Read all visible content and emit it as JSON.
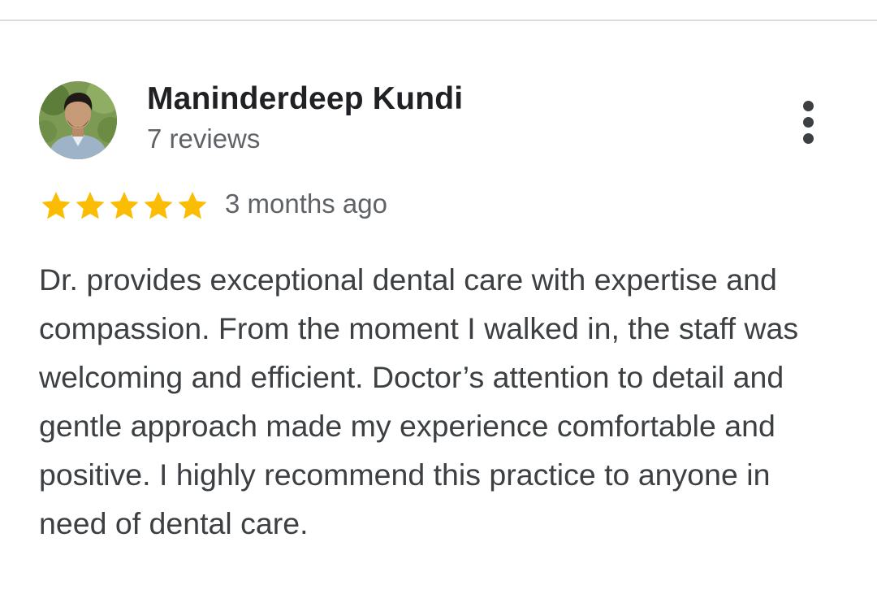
{
  "review": {
    "reviewer_name": "Maninderdeep Kundi",
    "review_count": "7 reviews",
    "rating": 5,
    "rating_max": 5,
    "date": "3 months ago",
    "text": "Dr. provides exceptional dental care with expertise and compassion. From the moment I walked in, the staff was welcoming and efficient. Doctor’s attention to detail and gentle approach made my experience comfortable and positive. I highly recommend this practice to anyone in need of dental care."
  },
  "icons": {
    "more": "more-vert-icon",
    "star": "star-icon"
  },
  "colors": {
    "star": "#fbbc04",
    "name": "#202124",
    "secondary": "#5f6368",
    "body": "#3c4043",
    "divider": "#dadce0"
  }
}
